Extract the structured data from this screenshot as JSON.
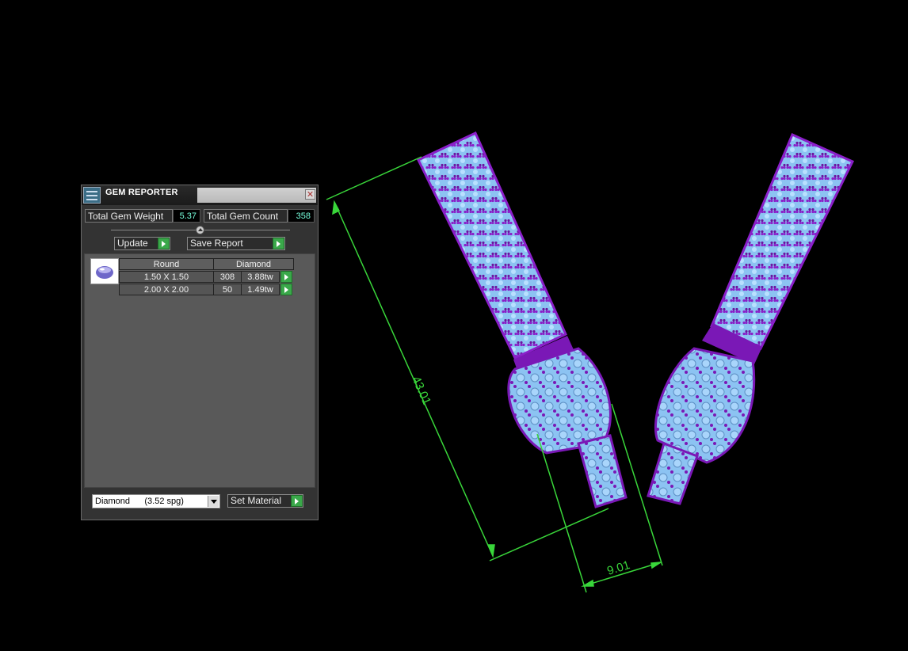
{
  "panel": {
    "title": "GEM REPORTER",
    "total_gem_weight_label": "Total Gem Weight",
    "total_gem_weight_value": "5.37",
    "total_gem_count_label": "Total Gem Count",
    "total_gem_count_value": "358",
    "update_label": "Update",
    "save_report_label": "Save Report",
    "table": {
      "shape": "Round",
      "material": "Diamond",
      "rows": [
        {
          "size": "1.50 X 1.50",
          "count": "308",
          "weight": "3.88tw"
        },
        {
          "size": "2.00 X 2.00",
          "count": "50",
          "weight": "1.49tw"
        }
      ]
    },
    "material_select_value": "Diamond      (3.52 spg)",
    "set_material_label": "Set Material"
  },
  "dimensions": {
    "length": "43.01",
    "width": "9.01"
  },
  "colors": {
    "dimension_line": "#39d63a",
    "metal": "#8a1fc9",
    "gem": "#8fc6f5",
    "button_arrow": "#3aa84a"
  }
}
